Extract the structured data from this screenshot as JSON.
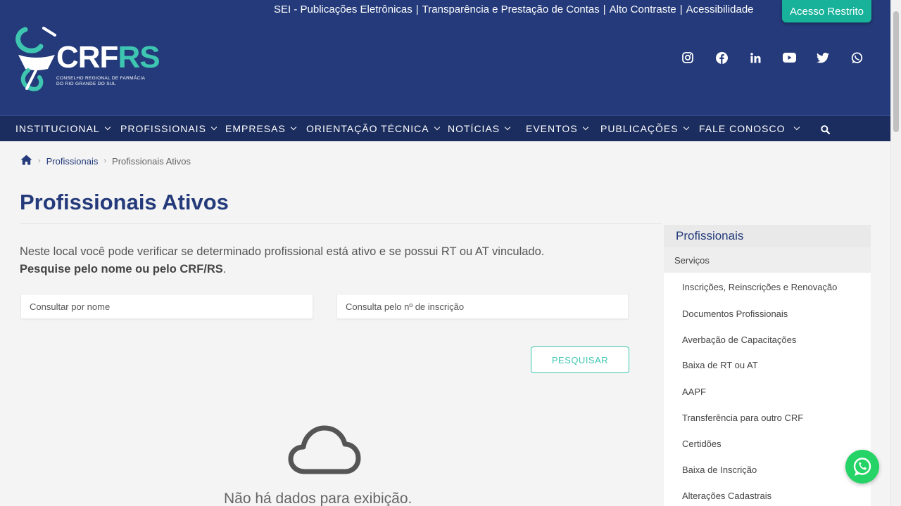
{
  "header": {
    "top_links": [
      "SEI - Publicações Eletrônicas",
      "Transparência e Prestação de Contas",
      "Alto Contraste",
      "Acessibilidade"
    ],
    "top_separator": "|",
    "restricted_button": "Acesso Restrito",
    "logo": {
      "crf": "CRF",
      "rs": "RS",
      "subtitle_line1": "CONSELHO REGIONAL DE FARMÁCIA",
      "subtitle_line2": "DO RIO GRANDE DO SUL"
    },
    "social_icons": [
      "instagram-icon",
      "facebook-icon",
      "linkedin-icon",
      "youtube-icon",
      "twitter-icon",
      "whatsapp-icon"
    ]
  },
  "nav": {
    "items": [
      {
        "label": "INSTITUCIONAL"
      },
      {
        "label": "PROFISSIONAIS"
      },
      {
        "label": "EMPRESAS"
      },
      {
        "label": "ORIENTAÇÃO TÉCNICA"
      },
      {
        "label": "NOTÍCIAS"
      },
      {
        "label": "EVENTOS"
      },
      {
        "label": "PUBLICAÇÕES"
      },
      {
        "label": "FALE CONOSCO"
      }
    ],
    "search_icon": "search-icon"
  },
  "breadcrumb": {
    "home_icon": "home-icon",
    "parent": "Profissionais",
    "current": "Profissionais Ativos"
  },
  "main": {
    "title": "Profissionais Ativos",
    "intro_line1": "Neste local você pode verificar se determinado profissional está ativo e se possui RT ou AT vinculado.",
    "intro_bold": "Pesquise pelo nome ou pelo CRF/RS",
    "intro_end": ".",
    "name_placeholder": "Consultar por nome",
    "number_placeholder": "Consulta pelo nº de inscrição",
    "search_button": "PESQUISAR",
    "empty_icon": "cloud-icon",
    "empty_text": "Não há dados para exibição."
  },
  "sidebar": {
    "title": "Profissionais",
    "section": "Serviços",
    "items": [
      {
        "label": "Inscrições, Reinscrições e Renovação"
      },
      {
        "label": "Documentos Profissionais"
      },
      {
        "label": "Averbação de Capacitações"
      },
      {
        "label": "Baixa de RT ou AT"
      },
      {
        "label": "AAPF"
      },
      {
        "label": "Transferência para outro CRF"
      },
      {
        "label": "Certidões"
      },
      {
        "label": "Baixa de Inscrição"
      },
      {
        "label": "Alterações Cadastrais"
      }
    ]
  },
  "colors": {
    "primary": "#243a7a",
    "nav": "#1b2c5e",
    "accent": "#18b19a",
    "whatsapp": "#25d366"
  }
}
